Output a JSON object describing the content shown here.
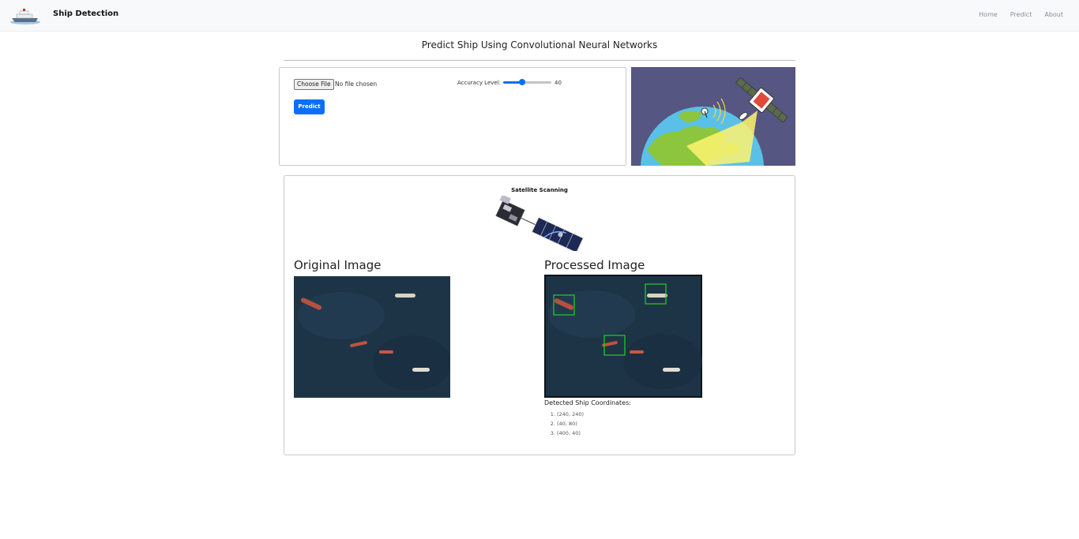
{
  "nav": {
    "brand": "Ship Detection",
    "links": [
      "Home",
      "Predict",
      "About"
    ]
  },
  "page": {
    "title": "Predict Ship Using Convolutional Neural Networks"
  },
  "upload": {
    "file_button": "Choose File",
    "file_status": "No file chosen",
    "accuracy_label": "Accuracy Level:",
    "accuracy_value": "40",
    "accuracy_fraction": 0.4,
    "predict_label": "Predict"
  },
  "results": {
    "scanning_label": "Satellite Scanning",
    "original_heading": "Original Image",
    "processed_heading": "Processed Image",
    "coords_label": "Detected Ship Coordinates:",
    "coordinates": [
      "(240, 240)",
      "(40, 80)",
      "(400, 40)"
    ]
  },
  "colors": {
    "primary": "#0d6efd",
    "navbar_bg": "#f8f9fa",
    "detection_box": "#1fd21f",
    "ocean": "#1d3447"
  }
}
